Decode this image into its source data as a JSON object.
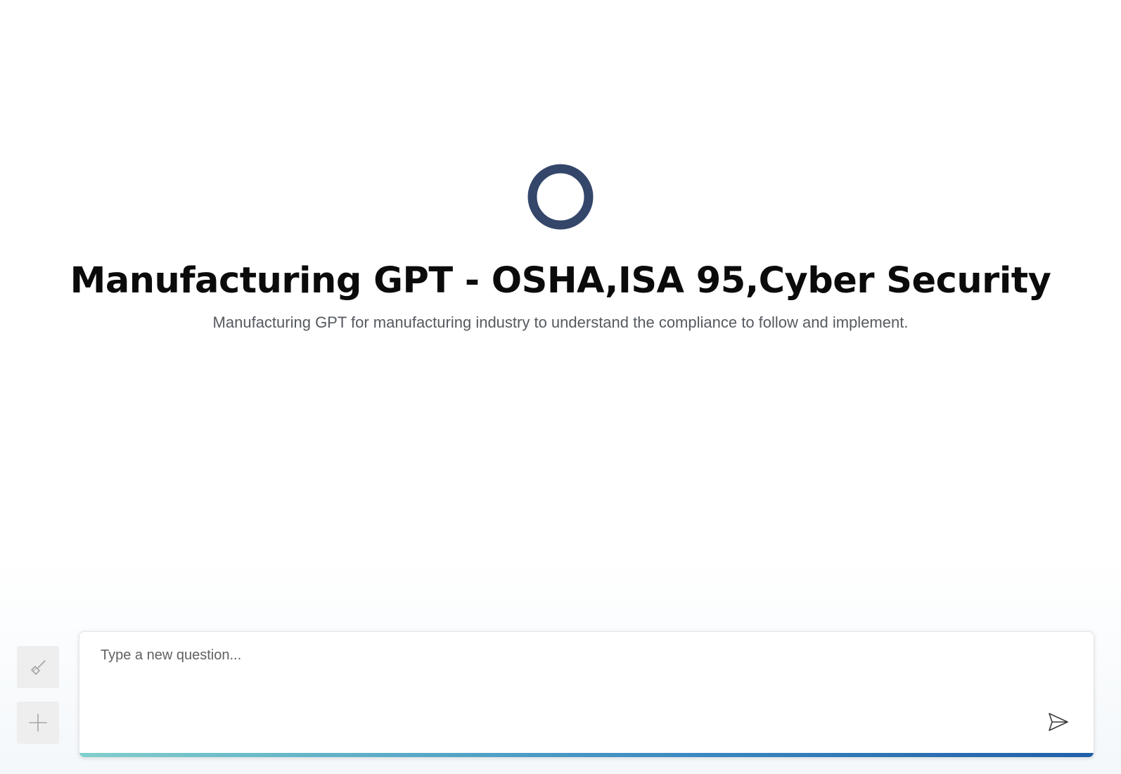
{
  "hero": {
    "logo_icon": "ring-logo-icon",
    "logo_color": "#34466a",
    "title": "Manufacturing GPT - OSHA,ISA 95,Cyber Security",
    "subtitle": "Manufacturing GPT for manufacturing industry to understand the compliance to follow and implement."
  },
  "sidebar": {
    "clear_icon": "broom-icon",
    "new_chat_icon": "plus-icon"
  },
  "composer": {
    "placeholder": "Type a new question...",
    "value": "",
    "send_icon": "send-icon",
    "accent_gradient": [
      "#7fcfcc",
      "#3f8fc4",
      "#1f5fa8"
    ]
  }
}
